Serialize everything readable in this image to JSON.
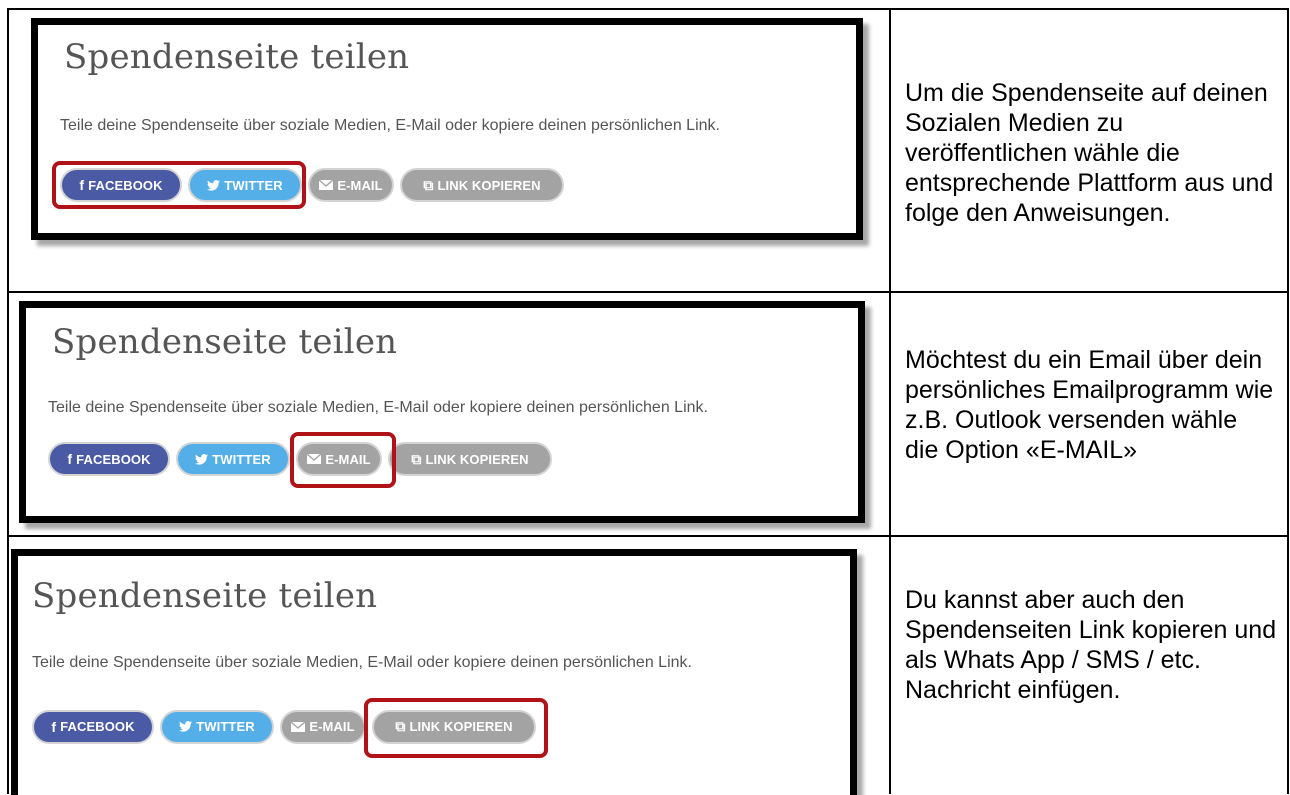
{
  "card": {
    "title": "Spendenseite teilen",
    "subtitle": "Teile deine Spendenseite über soziale Medien, E-Mail oder kopiere deinen persönlichen Link.",
    "buttons": {
      "facebook": "FACEBOOK",
      "twitter": "TWITTER",
      "email": "E-MAIL",
      "link": "LINK KOPIEREN"
    }
  },
  "rows": [
    {
      "description": "Um die Spendenseite auf deinen Sozialen Medien zu veröffentlichen wähle die entsprechende Plattform aus und folge den Anweisungen.",
      "highlighted": [
        "facebook",
        "twitter"
      ]
    },
    {
      "description": "Möchtest du ein Email über dein persönliches Emailprogramm wie z.B. Outlook versenden wähle die Option «E-MAIL»",
      "highlighted": [
        "email"
      ]
    },
    {
      "description": "Du kannst aber auch den Spendenseiten Link kopieren und als Whats App / SMS / etc. Nachricht einfügen.",
      "highlighted": [
        "link"
      ]
    }
  ],
  "colors": {
    "facebook": "#4a5aa5",
    "twitter": "#54aee8",
    "neutral": "#a3a3a3",
    "highlight": "#b01217"
  }
}
